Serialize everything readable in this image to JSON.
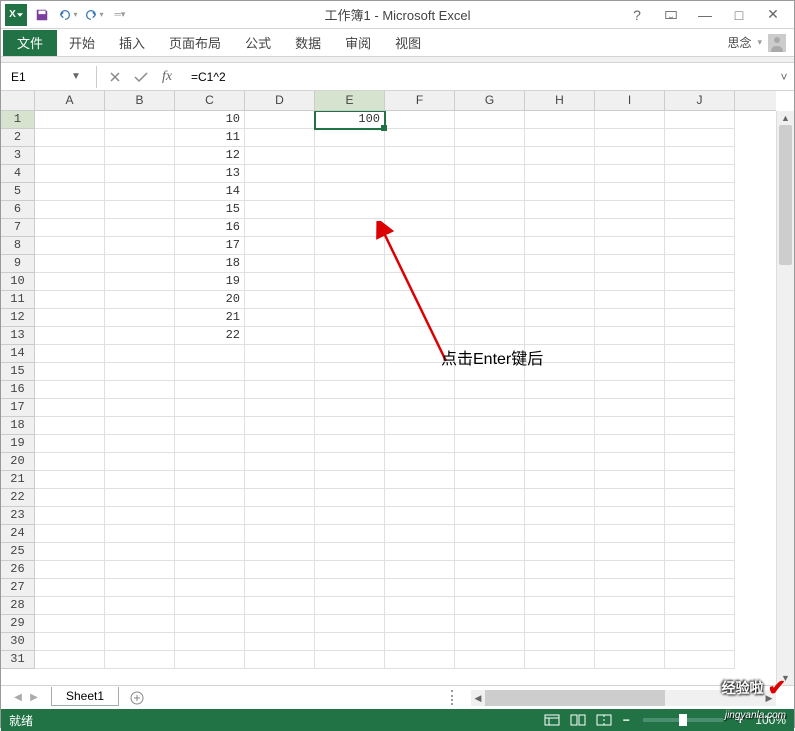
{
  "app": {
    "title": "工作簿1 - Microsoft Excel",
    "logo": "X"
  },
  "qat": {
    "save": "save",
    "undo": "undo",
    "redo": "redo",
    "sync": "sync"
  },
  "winctrl": {
    "help": "?",
    "ribbonmin": "▭",
    "min": "—",
    "max": "□",
    "close": "✕"
  },
  "tabs": {
    "file": "文件",
    "home": "开始",
    "insert": "插入",
    "layout": "页面布局",
    "formulas": "公式",
    "data": "数据",
    "review": "审阅",
    "view": "视图"
  },
  "user": {
    "name": "思念",
    "dd": "▾"
  },
  "formulabar": {
    "namebox": "E1",
    "formula": "=C1^2",
    "cancel": "✕",
    "enter": "✓",
    "fx": "fx",
    "expand": "˅"
  },
  "columns": [
    "A",
    "B",
    "C",
    "D",
    "E",
    "F",
    "G",
    "H",
    "I",
    "J"
  ],
  "active_col_index": 4,
  "rows": [
    1,
    2,
    3,
    4,
    5,
    6,
    7,
    8,
    9,
    10,
    11,
    12,
    13,
    14,
    15,
    16,
    17,
    18,
    19,
    20,
    21,
    22,
    23,
    24,
    25,
    26,
    27,
    28,
    29,
    30,
    31
  ],
  "active_row_index": 0,
  "cells": {
    "C": [
      "10",
      "11",
      "12",
      "13",
      "14",
      "15",
      "16",
      "17",
      "18",
      "19",
      "20",
      "21",
      "22"
    ],
    "E1": "100"
  },
  "annotation": {
    "text": "点击Enter键后"
  },
  "sheets": {
    "active": "Sheet1",
    "add": "+"
  },
  "statusbar": {
    "ready": "就绪",
    "zoom": "100%",
    "minus": "−",
    "plus": "+"
  },
  "watermark": {
    "brand": "经验啦",
    "url": "jingyanla.com"
  }
}
